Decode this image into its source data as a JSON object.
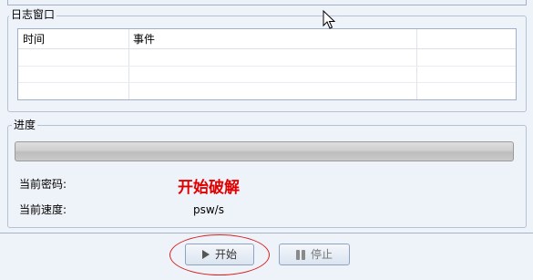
{
  "log_window": {
    "title": "日志窗口",
    "columns": [
      "时间",
      "事件",
      ""
    ],
    "rows": []
  },
  "progress": {
    "title": "进度",
    "value": 0
  },
  "fields": {
    "password_label": "当前密码:",
    "password_value": "",
    "speed_label": "当前速度:",
    "speed_value": "psw/s"
  },
  "annotation": "开始破解",
  "buttons": {
    "start_label": "开始",
    "stop_label": "停止"
  },
  "icons": {
    "start": "play-icon",
    "stop": "pause-icon",
    "cursor": "mouse-pointer-icon"
  },
  "colors": {
    "annotation": "#e00000",
    "highlight": "#d62020"
  }
}
